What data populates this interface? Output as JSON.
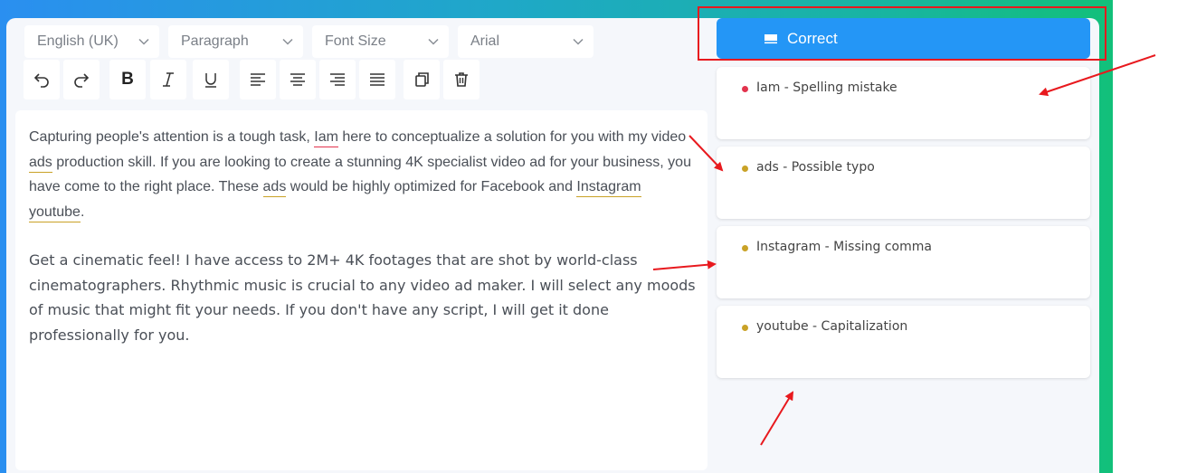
{
  "toolbar": {
    "language": "English (UK)",
    "block_style": "Paragraph",
    "font_size": "Font Size",
    "font_family": "Arial",
    "bold_label": "B"
  },
  "editor": {
    "p1": {
      "t1": "Capturing people's attention is a tough task, ",
      "e1": "Iam",
      "t2": " here to conceptualize a solution for you with my video ",
      "e2": "ads",
      "t3": " production skill. If you are looking to create a stunning 4K specialist video ad for your business, you have come to the right place. These ",
      "e3": "ads",
      "t4": " would be highly optimized for Facebook and ",
      "e4": "Instagram youtube",
      "t5": "."
    },
    "p2": "Get a cinematic feel! I have access to 2M+ 4K footages that are shot by world-class cinematographers. Rhythmic music is crucial to any video ad maker. I will select any moods of music that might fit your needs. If you don't have any script, I will get it done professionally for you."
  },
  "suggestions": {
    "correct_label": "Correct",
    "items": [
      {
        "text": "Iam - Spelling mistake",
        "color": "#e2334d"
      },
      {
        "text": "ads - Possible typo",
        "color": "#c9a227"
      },
      {
        "text": "Instagram - Missing comma",
        "color": "#c9a227"
      },
      {
        "text": "youtube - Capitalization",
        "color": "#c9a227"
      }
    ]
  },
  "colors": {
    "accent": "#2496f6",
    "error": "#e2334d",
    "warning": "#c9a227",
    "annotation": "#e8191e"
  }
}
